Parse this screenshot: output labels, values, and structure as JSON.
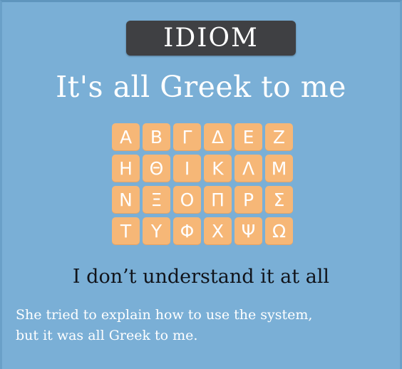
{
  "badge": {
    "label": "IDIOM"
  },
  "title": "It's all Greek to me",
  "greek_letters": [
    [
      "Α",
      "Β",
      "Γ",
      "Δ",
      "Ε",
      "Ζ"
    ],
    [
      "Η",
      "Θ",
      "Ι",
      "Κ",
      "Λ",
      "Μ"
    ],
    [
      "Ν",
      "Ξ",
      "Ο",
      "Π",
      "Ρ",
      "Σ"
    ],
    [
      "Τ",
      "Υ",
      "Φ",
      "Χ",
      "Ψ",
      "Ω"
    ]
  ],
  "meaning": "I don’t understand it at all",
  "example": {
    "line1": "She tried to explain how to use the system,",
    "line2": "but it was all Greek to me."
  },
  "colors": {
    "background": "#7aafd6",
    "badge": "#3f4043",
    "tile": "#f6b777",
    "meaning_text": "#10131a"
  }
}
